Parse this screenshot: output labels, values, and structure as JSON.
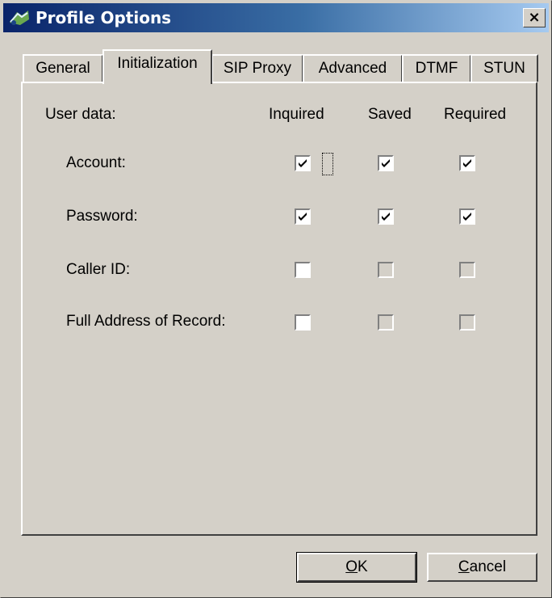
{
  "window": {
    "title": "Profile Options",
    "close_label": "×"
  },
  "tabs": [
    {
      "label": "General"
    },
    {
      "label": "Initialization"
    },
    {
      "label": "SIP Proxy"
    },
    {
      "label": "Advanced"
    },
    {
      "label": "DTMF"
    },
    {
      "label": "STUN"
    }
  ],
  "active_tab": "Initialization",
  "headers": {
    "user_data": "User data:",
    "inquired": "Inquired",
    "saved": "Saved",
    "required": "Required"
  },
  "rows": [
    {
      "label": "Account:",
      "inquired": true,
      "saved": true,
      "required": true,
      "saved_enabled": true,
      "required_enabled": true
    },
    {
      "label": "Password:",
      "inquired": true,
      "saved": true,
      "required": true,
      "saved_enabled": true,
      "required_enabled": true
    },
    {
      "label": "Caller ID:",
      "inquired": false,
      "saved": false,
      "required": false,
      "saved_enabled": false,
      "required_enabled": false
    },
    {
      "label": "Full Address of Record:",
      "inquired": false,
      "saved": false,
      "required": false,
      "saved_enabled": false,
      "required_enabled": false
    }
  ],
  "buttons": {
    "ok_mnemonic": "O",
    "ok_rest": "K",
    "cancel_mnemonic": "C",
    "cancel_rest": "ancel"
  }
}
